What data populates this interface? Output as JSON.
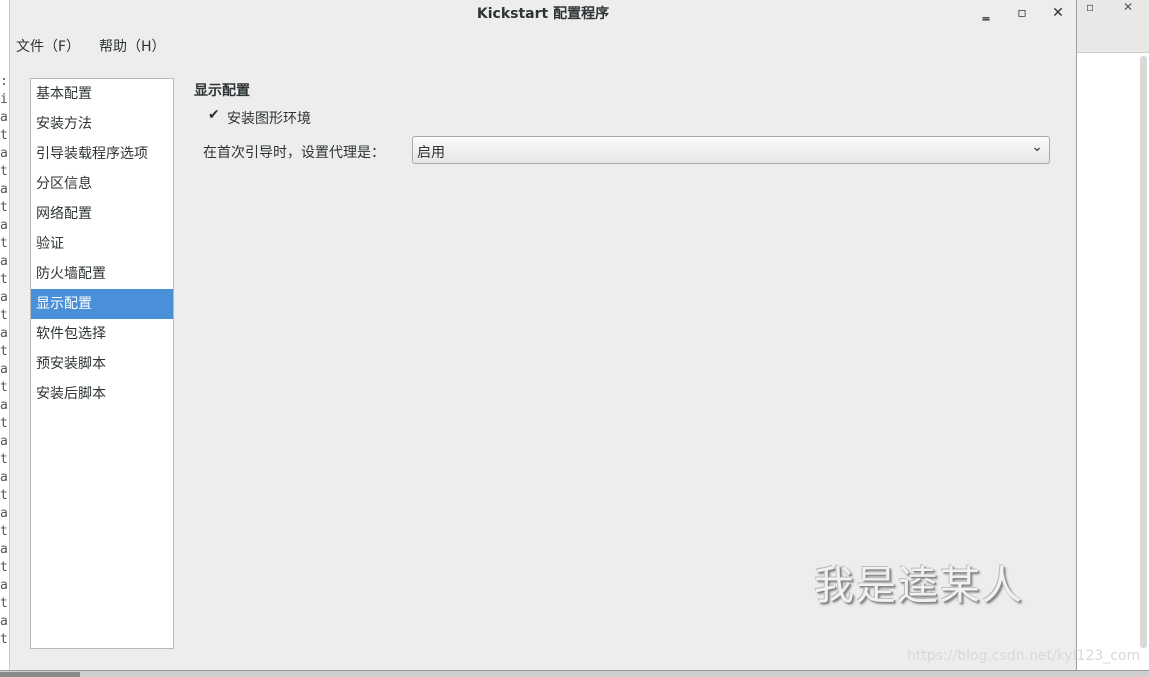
{
  "window": {
    "title": "Kickstart 配置程序",
    "minimize_glyph": "‗",
    "maximize_glyph": "▫",
    "close_glyph": "✕"
  },
  "menubar": {
    "items": [
      {
        "label": "文件（F）"
      },
      {
        "label": "帮助（H）"
      }
    ]
  },
  "sidebar": {
    "items": [
      {
        "label": "基本配置"
      },
      {
        "label": "安装方法"
      },
      {
        "label": "引导装载程序选项"
      },
      {
        "label": "分区信息"
      },
      {
        "label": "网络配置"
      },
      {
        "label": "验证"
      },
      {
        "label": "防火墙配置"
      },
      {
        "label": "显示配置",
        "selected": true
      },
      {
        "label": "软件包选择"
      },
      {
        "label": "预安装脚本"
      },
      {
        "label": "安装后脚本"
      }
    ],
    "selected_color": "#4a90d9"
  },
  "main": {
    "section_title": "显示配置",
    "install_graphical_env": {
      "label": "安装图形环境",
      "checked": true
    },
    "first_boot_agent": {
      "label": "在首次引导时，设置代理是：",
      "value": "启用"
    }
  },
  "background": {
    "left_lines": [
      ":",
      "i",
      "a",
      "t",
      "a",
      "t",
      "a",
      "t",
      "a",
      "t",
      "a",
      "t",
      "a",
      "t",
      "a",
      "t",
      "a",
      "t",
      "a",
      "t",
      "a",
      "t",
      "a",
      "t",
      "a",
      "t",
      "a",
      "t",
      "a",
      "t",
      "a",
      "t"
    ],
    "right_maximize_glyph": "▫",
    "right_close_glyph": "✕"
  },
  "watermarks": {
    "overlay_text": "我是逵某人",
    "footer_text": "https://blog.csdn.net/kyl123_com"
  },
  "icons": {
    "checkbox": "checkmark-icon",
    "dropdown": "chevron-down-icon"
  }
}
